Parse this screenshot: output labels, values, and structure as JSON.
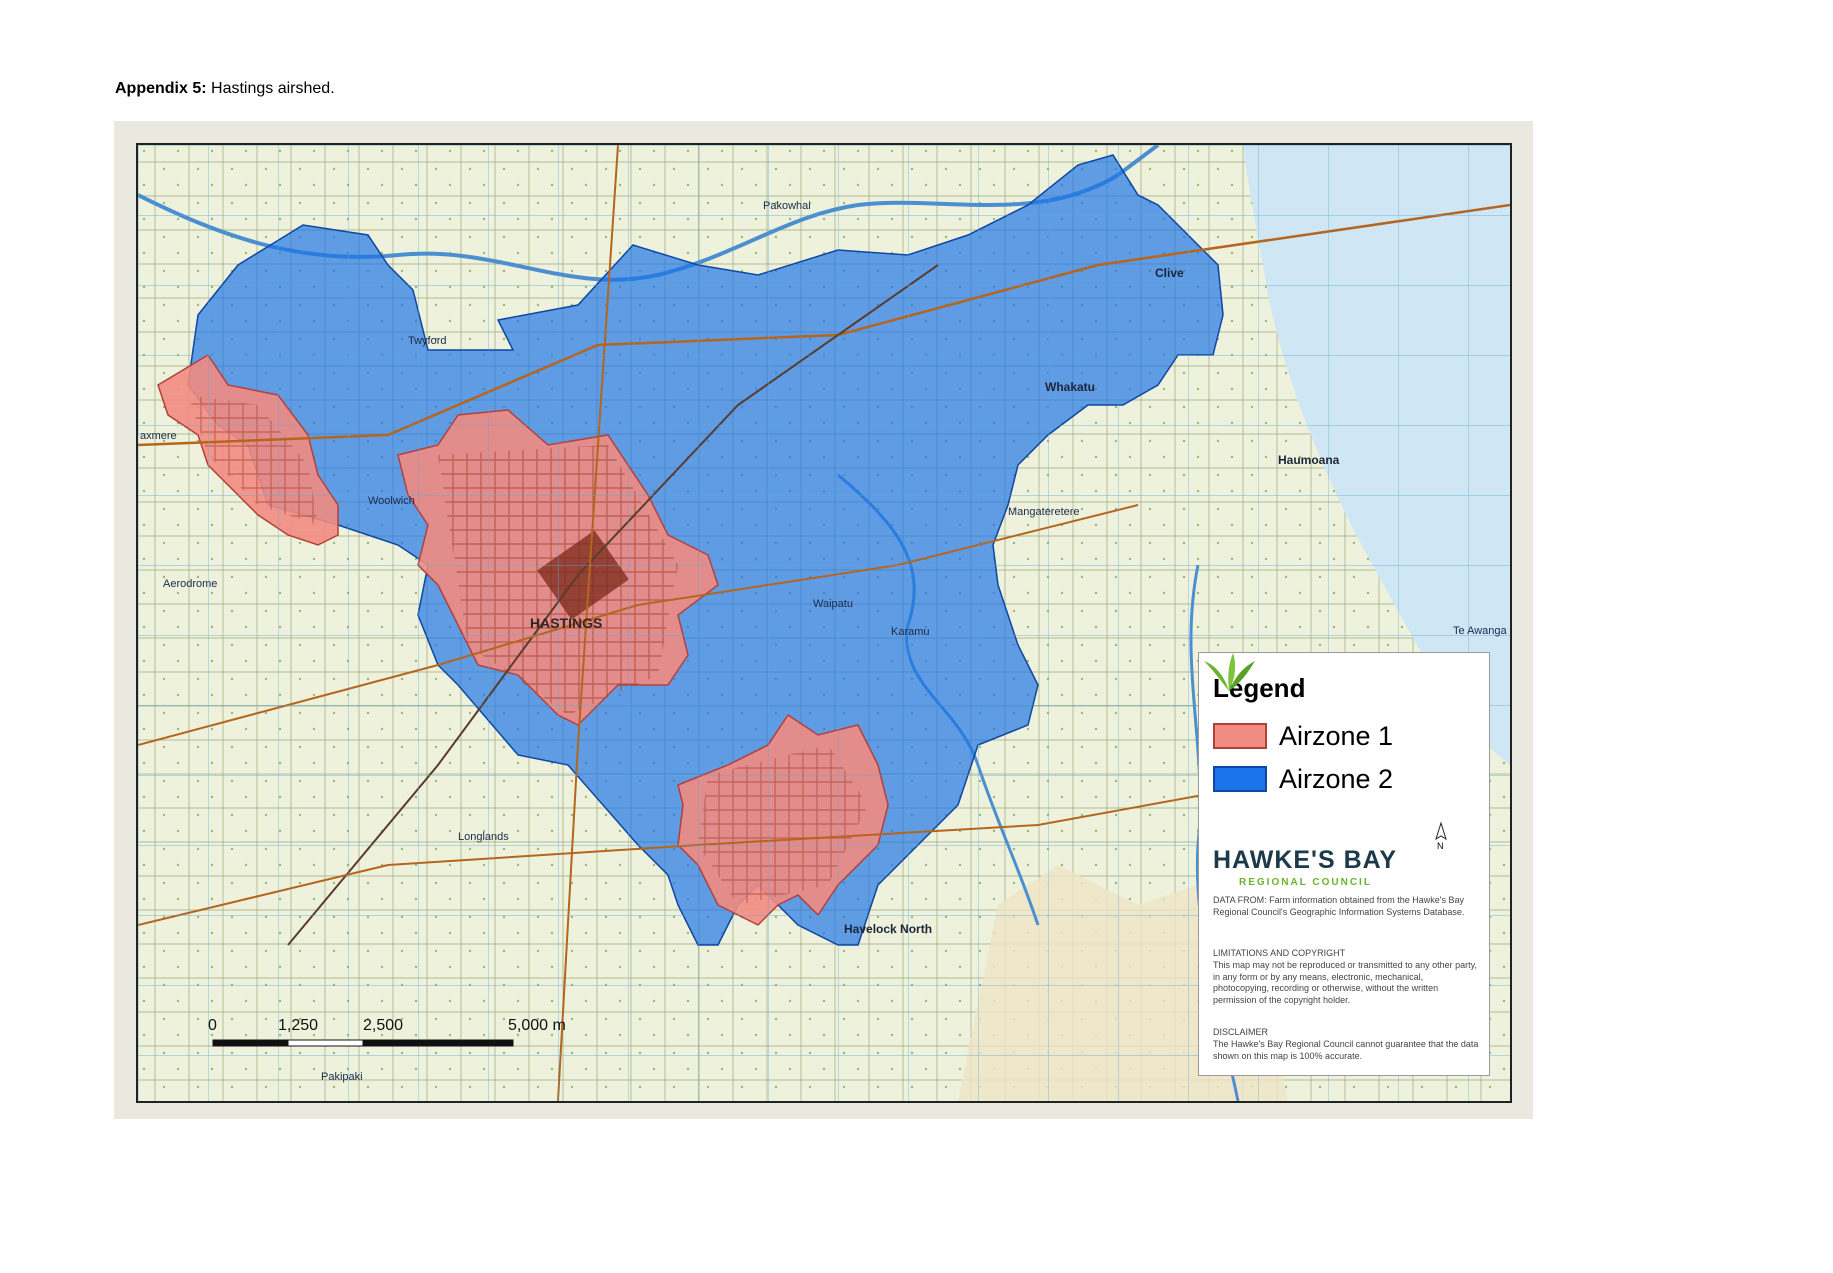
{
  "caption": {
    "label": "Appendix 5:",
    "text": "Hastings airshed."
  },
  "map": {
    "places": {
      "hastings": "HASTINGS",
      "havelock_north": "Havelock North",
      "clive": "Clive",
      "whakatu": "Whakatu",
      "haumoana": "Haumoana",
      "te_awanga": "Te Awanga",
      "flaxmere": "axmere",
      "twyford": "Twyford",
      "longlands": "Longlands",
      "pakipaki": "Pakipaki",
      "mangateretere": "Mangateretere",
      "waipatu": "Waipatu",
      "karamu": "Karamu",
      "pakowhai": "Pakowhai",
      "aerodrome": "Aerodrome",
      "woolwich": "Woolwich"
    },
    "legend": {
      "title": "Legend",
      "items": [
        {
          "label": "Airzone 1",
          "color": "#f28b82"
        },
        {
          "label": "Airzone 2",
          "color": "#1a73e8"
        }
      ]
    },
    "logo": {
      "name": "HAWKE'S BAY",
      "sub": "REGIONAL COUNCIL"
    },
    "north_label": "N",
    "notes": {
      "data_from": "DATA FROM: Farm information  obtained from the Hawke's Bay Regional Council's Geographic Information Systems Database.",
      "limitations_title": "LIMITATIONS AND COPYRIGHT",
      "limitations": "This map may not be reproduced or transmitted to any other party, in any form or by any means, electronic, mechanical, photocopying, recording or otherwise, without the written permission of the copyright holder.",
      "disclaimer_title": "DISCLAIMER",
      "disclaimer": "The Hawke's Bay Regional Council cannot guarantee that the data shown on this map is 100% accurate."
    },
    "scale_labels": [
      "0",
      "1,250",
      "2,500",
      "5,000 m"
    ],
    "colors": {
      "airzone1": "#f28b82",
      "airzone2": "#1a73e8",
      "sea": "#cfe6f5",
      "road": "#b5651d"
    }
  }
}
